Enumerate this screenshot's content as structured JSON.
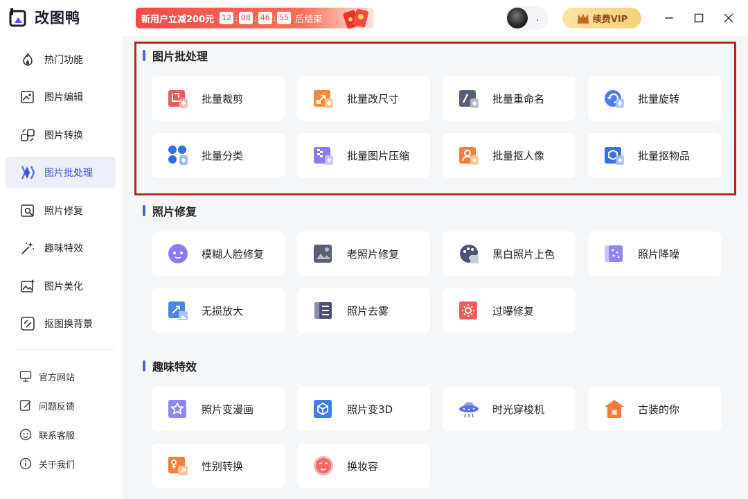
{
  "app": {
    "name": "改图鸭"
  },
  "promo": {
    "text": "新用户立减200元",
    "timer": [
      "12",
      "08",
      "46",
      "55"
    ],
    "end_text": "后结束"
  },
  "user": {
    "name": "."
  },
  "vip": {
    "label": "续费VIP"
  },
  "sidebar": {
    "items": [
      {
        "label": "热门功能",
        "icon": "fire-icon"
      },
      {
        "label": "图片编辑",
        "icon": "image-edit-icon"
      },
      {
        "label": "图片转换",
        "icon": "convert-icon"
      },
      {
        "label": "图片批处理",
        "icon": "batch-icon",
        "active": true
      },
      {
        "label": "照片修复",
        "icon": "photo-repair-icon"
      },
      {
        "label": "趣味特效",
        "icon": "magic-wand-icon"
      },
      {
        "label": "图片美化",
        "icon": "image-beautify-icon"
      },
      {
        "label": "抠图换背景",
        "icon": "cutout-icon"
      }
    ],
    "footer": [
      {
        "label": "官方网站",
        "icon": "monitor-icon"
      },
      {
        "label": "问题反馈",
        "icon": "feedback-icon"
      },
      {
        "label": "联系客服",
        "icon": "support-icon"
      },
      {
        "label": "关于我们",
        "icon": "info-icon"
      }
    ]
  },
  "sections": [
    {
      "title": "图片批处理",
      "items": [
        {
          "label": "批量裁剪",
          "icon": "crop-icon",
          "color": "#ef5a5a"
        },
        {
          "label": "批量改尺寸",
          "icon": "resize-icon",
          "color": "#f58a3a"
        },
        {
          "label": "批量重命名",
          "icon": "rename-icon",
          "color": "#5a5f78"
        },
        {
          "label": "批量旋转",
          "icon": "rotate-icon",
          "color": "#4a7ee8"
        },
        {
          "label": "批量分类",
          "icon": "classify-icon",
          "color": "#2f6fe6"
        },
        {
          "label": "批量图片压缩",
          "icon": "compress-icon",
          "color": "#8c7cf0"
        },
        {
          "label": "批量抠人像",
          "icon": "portrait-cutout-icon",
          "color": "#f0803c"
        },
        {
          "label": "批量抠物品",
          "icon": "object-cutout-icon",
          "color": "#3a6fe6"
        }
      ]
    },
    {
      "title": "照片修复",
      "items": [
        {
          "label": "模糊人脸修复",
          "icon": "face-repair-icon",
          "color": "#8a7cf0"
        },
        {
          "label": "老照片修复",
          "icon": "old-photo-icon",
          "color": "#5a5f78"
        },
        {
          "label": "黑白照片上色",
          "icon": "palette-icon",
          "color": "#4c5272"
        },
        {
          "label": "照片降噪",
          "icon": "denoise-icon",
          "color": "#8f86f2"
        },
        {
          "label": "无损放大",
          "icon": "enlarge-icon",
          "color": "#4a86ea"
        },
        {
          "label": "照片去雾",
          "icon": "dehaze-icon",
          "color": "#4c5272"
        },
        {
          "label": "过曝修复",
          "icon": "overexposure-icon",
          "color": "#ef5a5a"
        }
      ]
    },
    {
      "title": "趣味特效",
      "items": [
        {
          "label": "照片变漫画",
          "icon": "comic-icon",
          "color": "#8f86f2"
        },
        {
          "label": "照片变3D",
          "icon": "cube-3d-icon",
          "color": "#3d7fe9"
        },
        {
          "label": "时光穿梭机",
          "icon": "time-machine-icon",
          "color": "#5a6eea"
        },
        {
          "label": "古装的你",
          "icon": "ancient-costume-icon",
          "color": "#f07a3a"
        },
        {
          "label": "性别转换",
          "icon": "gender-swap-icon",
          "color": "#f0803c"
        },
        {
          "label": "换妆容",
          "icon": "makeup-icon",
          "color": "#ef6b6b"
        }
      ]
    }
  ]
}
